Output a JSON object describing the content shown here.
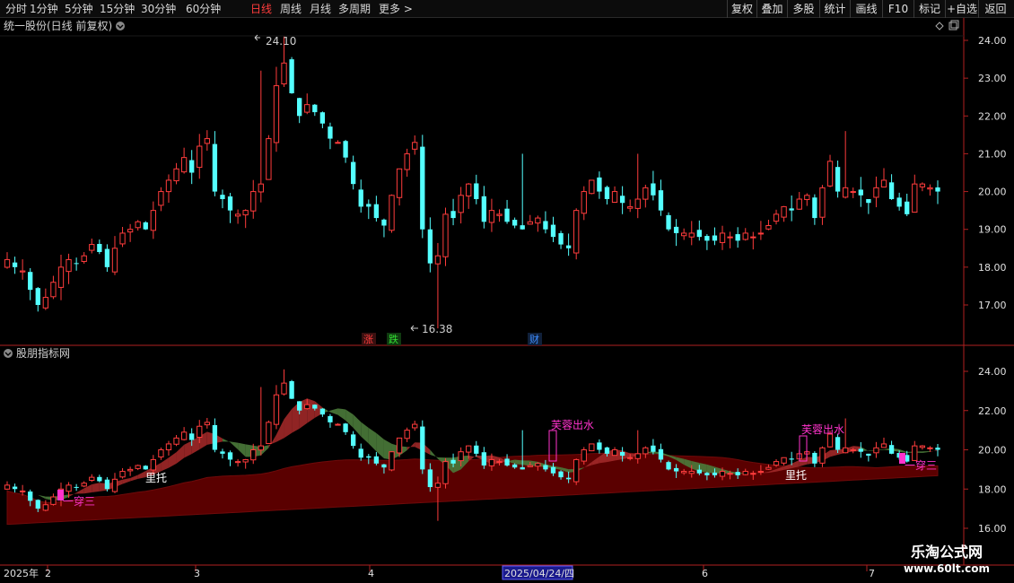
{
  "toolbar": {
    "periods": [
      "分时",
      "1分钟",
      "5分钟",
      "15分钟",
      "30分钟",
      "60分钟",
      "日线",
      "周线",
      "月线",
      "多周期",
      "更多 >"
    ],
    "active_period": "日线",
    "buttons": [
      "复权",
      "叠加",
      "多股",
      "统计",
      "画线",
      "F10",
      "标记",
      "+自选",
      "返回"
    ]
  },
  "main_panel": {
    "title": "统一股份(日线 前复权)",
    "high_label": "24.10",
    "low_label": "16.38",
    "event_badges": [
      {
        "text": "涨",
        "color": "#ff3c3c"
      },
      {
        "text": "跌",
        "color": "#33dd33"
      },
      {
        "text": "财",
        "color": "#3c8cff"
      }
    ]
  },
  "indicator_panel": {
    "title": "股朋指标网",
    "signals": [
      {
        "text": "一穿三",
        "color": "#ff33cc"
      },
      {
        "text": "里托",
        "color": "#ffffff"
      },
      {
        "text": "芙蓉出水",
        "color": "#ff33cc"
      },
      {
        "text": "里托",
        "color": "#ffffff"
      },
      {
        "text": "芙蓉出水",
        "color": "#ff33cc"
      },
      {
        "text": "一穿三",
        "color": "#ff33cc"
      }
    ]
  },
  "x_axis": {
    "labels": [
      "2025年",
      "2",
      "3",
      "4",
      "2025/04/24/四",
      "6",
      "7"
    ]
  },
  "watermark": {
    "name": "乐淘公式网",
    "url": "www.60lt.com"
  },
  "icons": {
    "dropdown": "chevron-down-icon",
    "diamond": "diamond-icon",
    "copy": "window-icon"
  },
  "chart_data": {
    "type": "candlestick",
    "up_color": "#ff3c3c",
    "down_color": "#54ffff",
    "y_axis_main": [
      24.0,
      23.0,
      22.0,
      21.0,
      20.0,
      19.0,
      18.0,
      17.0
    ],
    "y_axis_indicator": [
      24.0,
      22.0,
      20.0,
      18.0,
      16.0
    ],
    "closes": [
      18.2,
      18.0,
      17.9,
      17.4,
      17.0,
      17.2,
      17.6,
      18.0,
      18.2,
      18.1,
      18.3,
      18.6,
      18.4,
      18.0,
      18.5,
      18.9,
      19.0,
      19.2,
      19.0,
      19.5,
      20.0,
      20.3,
      20.6,
      20.9,
      20.5,
      21.2,
      21.4,
      20.0,
      19.8,
      19.5,
      19.4,
      19.5,
      20.0,
      20.2,
      21.4,
      22.8,
      23.4,
      22.6,
      22.0,
      22.3,
      22.1,
      21.8,
      21.4,
      21.3,
      20.9,
      20.2,
      19.6,
      19.6,
      19.3,
      19.1,
      19.9,
      20.6,
      21.0,
      21.3,
      19.0,
      18.1,
      18.3,
      19.4,
      19.3,
      19.9,
      20.2,
      19.8,
      19.2,
      19.5,
      19.4,
      19.2,
      19.1,
      19.0,
      19.2,
      19.3,
      19.0,
      18.8,
      18.6,
      18.5,
      19.5,
      20.0,
      20.3,
      20.0,
      19.8,
      20.0,
      19.7,
      19.6,
      19.8,
      20.1,
      19.9,
      19.5,
      19.0,
      18.9,
      18.9,
      18.9,
      18.8,
      18.7,
      18.7,
      18.9,
      18.8,
      18.7,
      18.9,
      18.8,
      18.9,
      19.1,
      19.4,
      19.6,
      19.5,
      19.8,
      19.9,
      19.3,
      20.1,
      20.8,
      20.0,
      20.1,
      20.0,
      19.9,
      19.7,
      20.1,
      20.3,
      19.8,
      19.6,
      19.4,
      20.2,
      20.2,
      20.1,
      20.0
    ],
    "high": 24.1,
    "low": 16.38
  }
}
